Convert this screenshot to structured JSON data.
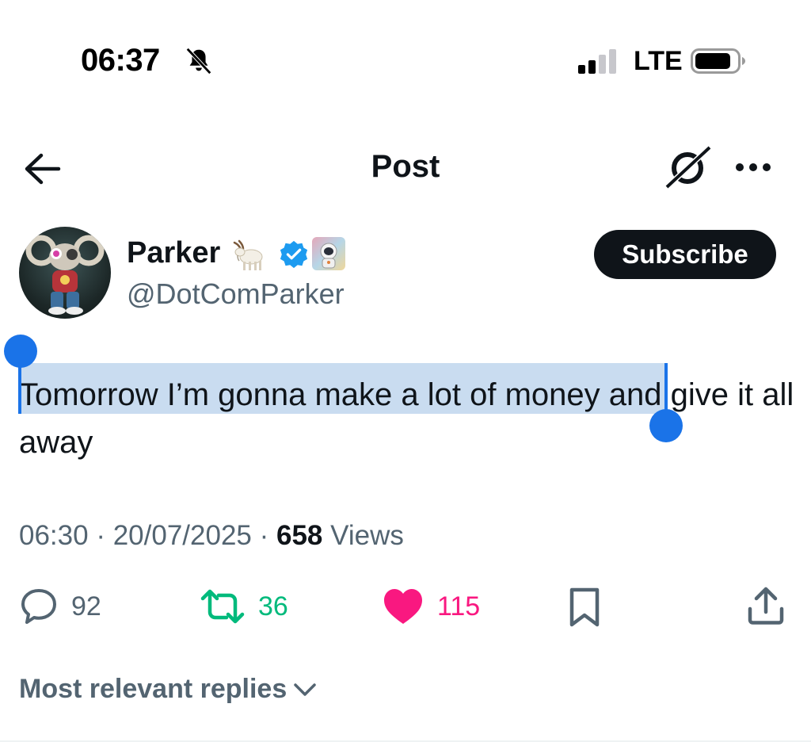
{
  "status_bar": {
    "time": "06:37",
    "network": "LTE",
    "icons": [
      "bell-slash-icon",
      "signal-icon",
      "battery-icon"
    ]
  },
  "header": {
    "title": "Post",
    "icons": [
      "arrow-left-icon",
      "grok-icon",
      "more-icon"
    ]
  },
  "author": {
    "name": "Parker",
    "handle": "@DotComParker",
    "badges": [
      "goat-emoji",
      "verified-icon",
      "affiliate-badge"
    ],
    "subscribe_label": "Subscribe"
  },
  "post": {
    "text": "Tomorrow I’m gonna make a lot of money and give it all away",
    "selected_text": "Tomorrow I’m gonna make a lot of money",
    "time": "06:30",
    "separator": " · ",
    "date": "20/07/2025",
    "views_count": "658",
    "views_label": " Views"
  },
  "actions": {
    "replies": "92",
    "reposts": "36",
    "likes": "115",
    "liked": true
  },
  "replies_sort": {
    "label": "Most relevant replies"
  },
  "colors": {
    "text": "#0f1419",
    "secondary": "#536471",
    "selection": "#c9dcf0",
    "selection_handle": "#1a73e8",
    "repost_green": "#00ba7c",
    "like_pink": "#f91880",
    "verified_blue": "#1d9bf0"
  }
}
